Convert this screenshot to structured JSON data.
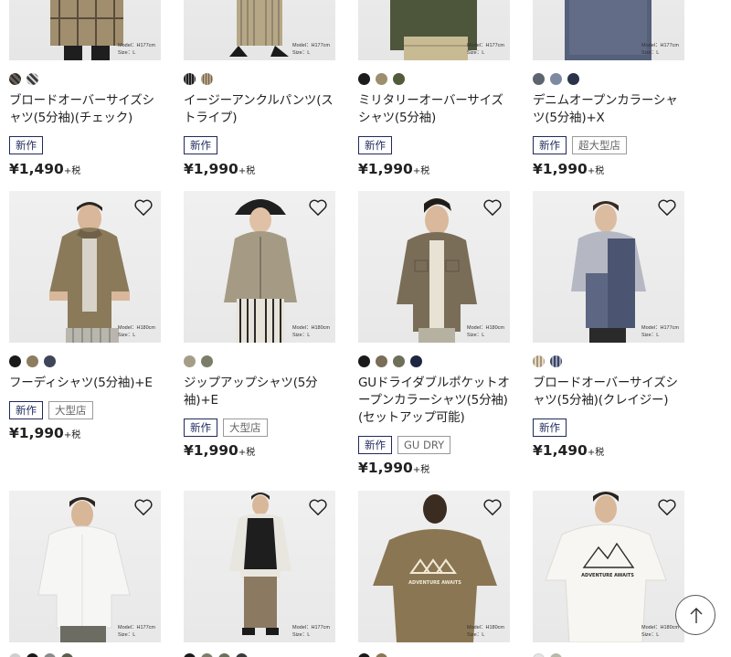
{
  "products": [
    {
      "title": "ブロードオーバーサイズシャツ(5分袖)(チェック)",
      "badges": [
        {
          "text": "新作",
          "kind": "new"
        }
      ],
      "price": "¥1,490",
      "tax": "+税",
      "model": "Model：H177cm",
      "size": "Size：L",
      "swatches": [
        "#6b6258",
        "#3a3a3a"
      ],
      "wishlist": false
    },
    {
      "title": "イージーアンクルパンツ(ストライプ)",
      "badges": [
        {
          "text": "新作",
          "kind": "new"
        }
      ],
      "price": "¥1,990",
      "tax": "+税",
      "model": "Model：H177cm",
      "size": "Size：L",
      "swatches": [
        "#1f1f1f",
        "#b4a382"
      ],
      "wishlist": false
    },
    {
      "title": "ミリタリーオーバーサイズシャツ(5分袖)",
      "badges": [
        {
          "text": "新作",
          "kind": "new"
        }
      ],
      "price": "¥1,990",
      "tax": "+税",
      "model": "Model：H177cm",
      "size": "Size：L",
      "swatches": [
        "#1c1c1c",
        "#9c8e6e",
        "#525a3c"
      ],
      "wishlist": false
    },
    {
      "title": "デニムオープンカラーシャツ(5分袖)+X",
      "badges": [
        {
          "text": "新作",
          "kind": "new"
        },
        {
          "text": "超大型店",
          "kind": "grey"
        }
      ],
      "price": "¥1,990",
      "tax": "+税",
      "model": "Model：H177cm",
      "size": "Size：L",
      "swatches": [
        "#5d6470",
        "#7d8aa1",
        "#2a3348"
      ],
      "wishlist": false
    },
    {
      "title": "フーディシャツ(5分袖)+E",
      "badges": [
        {
          "text": "新作",
          "kind": "new"
        },
        {
          "text": "大型店",
          "kind": "grey"
        }
      ],
      "price": "¥1,990",
      "tax": "+税",
      "model": "Model：H180cm",
      "size": "Size：L",
      "swatches": [
        "#1a1a1a",
        "#8d7d5e",
        "#3f465a"
      ],
      "wishlist": true
    },
    {
      "title": "ジップアップシャツ(5分袖)+E",
      "badges": [
        {
          "text": "新作",
          "kind": "new"
        },
        {
          "text": "大型店",
          "kind": "grey"
        }
      ],
      "price": "¥1,990",
      "tax": "+税",
      "model": "Model：H180cm",
      "size": "Size：L",
      "swatches": [
        "#a59d88",
        "#7c7d68"
      ],
      "wishlist": true
    },
    {
      "title": "GUドライダブルポケットオープンカラーシャツ(5分袖)(セットアップ可能)",
      "badges": [
        {
          "text": "新作",
          "kind": "new"
        },
        {
          "text": "GU DRY",
          "kind": "grey"
        }
      ],
      "price": "¥1,990",
      "tax": "+税",
      "model": "Model：H180cm",
      "size": "Size：L",
      "swatches": [
        "#1a1a1a",
        "#7a6d58",
        "#6d6f58",
        "#1f2640"
      ],
      "wishlist": true
    },
    {
      "title": "ブロードオーバーサイズシャツ(5分袖)(クレイジー)",
      "badges": [
        {
          "text": "新作",
          "kind": "new"
        }
      ],
      "price": "¥1,490",
      "tax": "+税",
      "model": "Model：H177cm",
      "size": "Size：L",
      "swatches": [
        "#a8957a",
        "#3d4460"
      ],
      "wishlist": true
    },
    {
      "title": "",
      "badges": [],
      "price": "",
      "tax": "",
      "model": "Model：H177cm",
      "size": "Size：L",
      "swatches": [
        "#cfcfcf",
        "#1a1a1a",
        "#8a8a8a",
        "#5d5d4d"
      ],
      "wishlist": true
    },
    {
      "title": "",
      "badges": [],
      "price": "",
      "tax": "",
      "model": "Model：H177cm",
      "size": "Size：L",
      "swatches": [
        "#1a1a1a",
        "#7f7a6a",
        "#6a6f5a",
        "#3a3a3a"
      ],
      "wishlist": true
    },
    {
      "title": "",
      "badges": [],
      "price": "",
      "tax": "",
      "model": "Model：H180cm",
      "size": "Size：L",
      "swatches": [
        "#1a1a1a",
        "#8a7654"
      ],
      "wishlist": true
    },
    {
      "title": "",
      "badges": [],
      "price": "",
      "tax": "",
      "model": "Model：H180cm",
      "size": "Size：L",
      "swatches": [
        "#e5e5e5",
        "#b9b9a9"
      ],
      "wishlist": true
    }
  ],
  "graphics": {
    "tee3": "ADVENTURE AWAITS",
    "tee4": "ADVENTURE AWAITS"
  },
  "scroll_top_icon": "arrow-up-icon"
}
